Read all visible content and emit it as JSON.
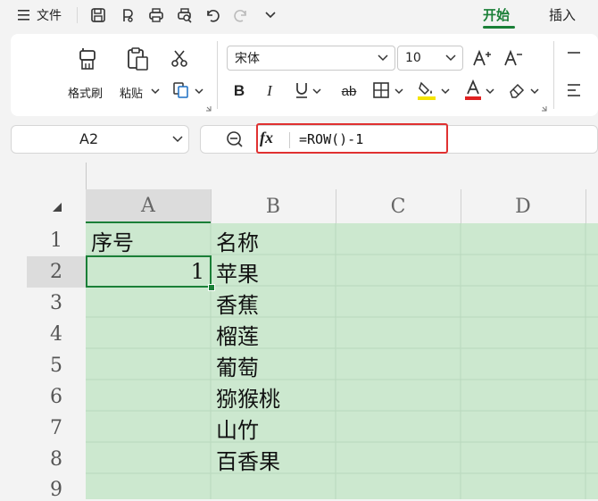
{
  "menu": {
    "label": "文件"
  },
  "tabs": [
    {
      "label": "开始",
      "active": true
    },
    {
      "label": "插入",
      "active": false
    }
  ],
  "ribbon": {
    "format_painter": "格式刷",
    "paste": "粘贴",
    "font_name": "宋体",
    "font_size": "10"
  },
  "formula_bar": {
    "cell_ref": "A2",
    "fx": "fx",
    "formula": "=ROW()-1"
  },
  "sheet": {
    "columns": [
      "A",
      "B",
      "C",
      "D"
    ],
    "rows": [
      "1",
      "2",
      "3",
      "4",
      "5",
      "6",
      "7",
      "8",
      "9"
    ],
    "cells": {
      "A1": "序号",
      "A2": "1",
      "B1": "名称",
      "B2": "苹果",
      "B3": "香蕉",
      "B4": "榴莲",
      "B5": "葡萄",
      "B6": "猕猴桃",
      "B7": "山竹",
      "B8": "百香果"
    },
    "active_cell": "A2"
  },
  "colors": {
    "accent": "#1a7f37",
    "selection_fill": "#cce8cf",
    "highlight_box": "#e03131"
  }
}
